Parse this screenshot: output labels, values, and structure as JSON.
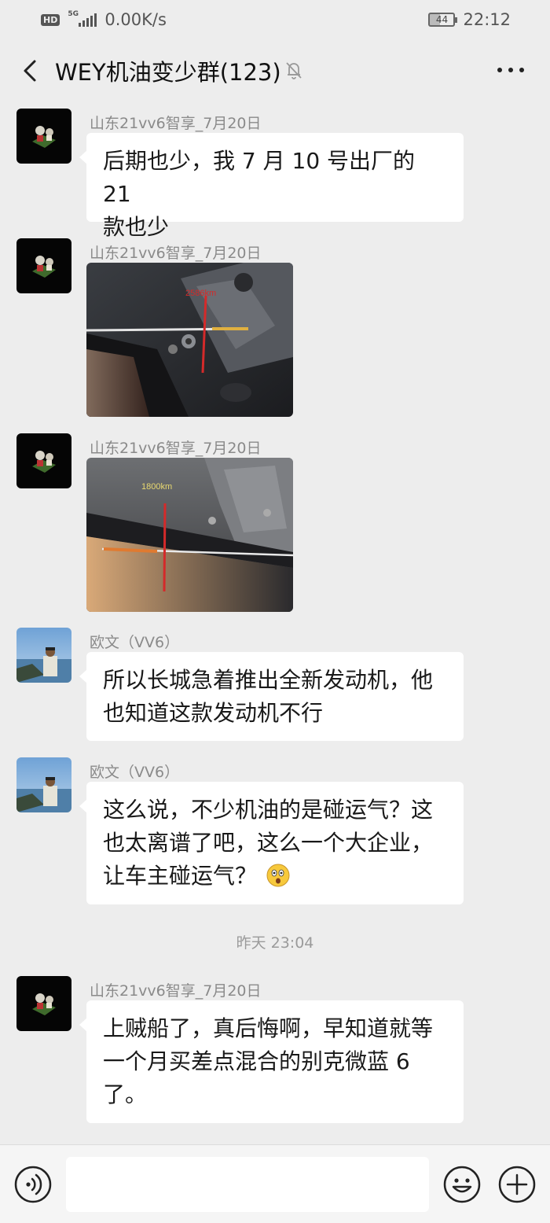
{
  "status_bar": {
    "hd_label": "HD",
    "network_label": "5G",
    "speed": "0.00K/s",
    "battery": "44",
    "time": "22:12"
  },
  "header": {
    "title": "WEY机油变少群(123)",
    "back_icon": "back-arrow-icon",
    "mute_icon": "bell-muted-icon",
    "more_icon": "more-dots-icon"
  },
  "messages": [
    {
      "sender": "山东21vv6智享_7月20日",
      "type": "text",
      "lines": [
        "后期也少，我 7 月 10 号出厂的 21",
        "款也少"
      ]
    },
    {
      "sender": "山东21vv6智享_7月20日",
      "type": "image",
      "image_label": "2586km"
    },
    {
      "sender": "山东21vv6智享_7月20日",
      "type": "image",
      "image_label": "1800km"
    },
    {
      "sender": "欧文（VV6）",
      "type": "text",
      "lines": [
        "所以长城急着推出全新发动机，他",
        "也知道这款发动机不行"
      ]
    },
    {
      "sender": "欧文（VV6）",
      "type": "text",
      "lines": [
        "这么说，不少机油的是碰运气？这",
        "也太离谱了吧，这么一个大企业，",
        "让车主碰运气？"
      ],
      "emoji": "surprised-face-emoji"
    },
    {
      "sender": "山东21vv6智享_7月20日",
      "type": "text",
      "lines": [
        "上贼船了，真后悔啊，早知道就等",
        "一个月买差点混合的别克微蓝 6",
        "了。"
      ]
    }
  ],
  "timestamp": "昨天 23:04",
  "input_bar": {
    "voice_icon": "voice-icon",
    "input_value": "",
    "emoji_icon": "emoji-icon",
    "plus_icon": "plus-icon"
  },
  "colors": {
    "background": "#ededed",
    "bubble": "#ffffff",
    "meta_text": "#8a8a8a",
    "measure_line": "#d42a2a",
    "image_label": "#e8d870"
  }
}
